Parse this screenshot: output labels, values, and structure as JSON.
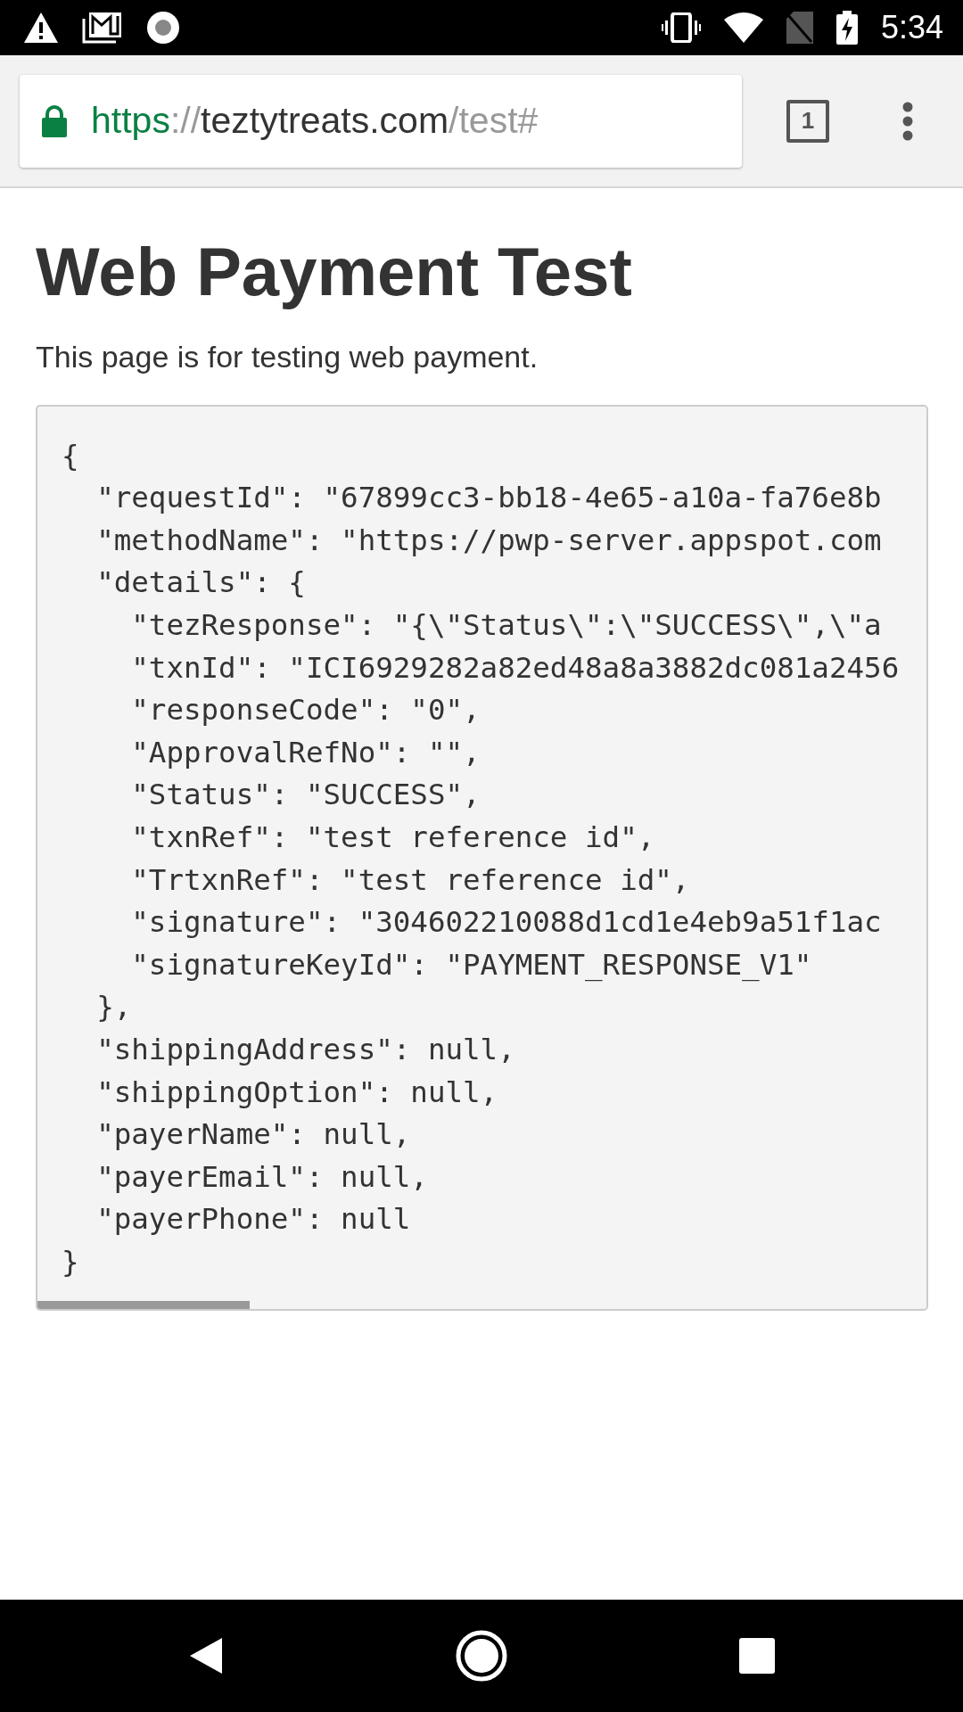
{
  "status_bar": {
    "time": "5:34"
  },
  "address_bar": {
    "scheme": "https",
    "separator": "://",
    "host": "teztytreats.com",
    "path": "/test#",
    "secure": true
  },
  "tab_count": "1",
  "page": {
    "title": "Web Payment Test",
    "description": "This page is for testing web payment.",
    "code_lines": [
      "{",
      "  \"requestId\": \"67899cc3-bb18-4e65-a10a-fa76e8b",
      "  \"methodName\": \"https://pwp-server.appspot.com",
      "  \"details\": {",
      "    \"tezResponse\": \"{\\\"Status\\\":\\\"SUCCESS\\\",\\\"a",
      "    \"txnId\": \"ICI6929282a82ed48a8a3882dc081a2456",
      "    \"responseCode\": \"0\",",
      "    \"ApprovalRefNo\": \"\",",
      "    \"Status\": \"SUCCESS\",",
      "    \"txnRef\": \"test reference id\",",
      "    \"TrtxnRef\": \"test reference id\",",
      "    \"signature\": \"304602210088d1cd1e4eb9a51f1ac",
      "    \"signatureKeyId\": \"PAYMENT_RESPONSE_V1\"",
      "  },",
      "  \"shippingAddress\": null,",
      "  \"shippingOption\": null,",
      "  \"payerName\": null,",
      "  \"payerEmail\": null,",
      "  \"payerPhone\": null",
      "}"
    ]
  }
}
